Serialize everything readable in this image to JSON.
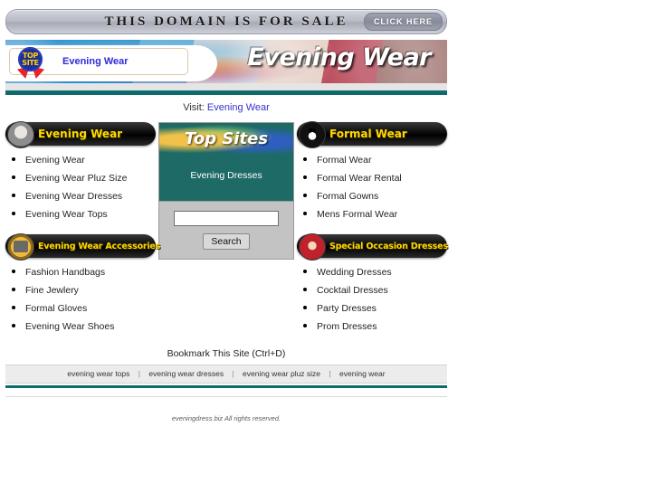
{
  "top_bar": {
    "sale_text": "THIS DOMAIN IS FOR SALE",
    "click_here": "CLICK HERE"
  },
  "header": {
    "badge_top": "TOP",
    "badge_site": "SITE",
    "tab_label": "Evening Wear",
    "banner_title": "Evening Wear"
  },
  "visit": {
    "prefix": "Visit:",
    "link": "Evening Wear"
  },
  "columns": {
    "left": [
      {
        "title": "Evening Wear",
        "icon": "evening-dress-icon",
        "links": [
          "Evening Wear",
          "Evening Wear Pluz Size",
          "Evening Wear Dresses",
          "Evening Wear Tops"
        ]
      },
      {
        "title": "Evening Wear Accessories",
        "icon": "handbag-icon",
        "links": [
          "Fashion Handbags",
          "Fine Jewlery",
          "Formal Gloves",
          "Evening Wear Shoes"
        ]
      }
    ],
    "right": [
      {
        "title": "Formal Wear",
        "icon": "tuxedo-icon",
        "links": [
          "Formal Wear",
          "Formal Wear Rental",
          "Formal Gowns",
          "Mens Formal Wear"
        ]
      },
      {
        "title": "Special Occasion Dresses",
        "icon": "red-dress-icon",
        "links": [
          "Wedding Dresses",
          "Cocktail Dresses",
          "Party Dresses",
          "Prom Dresses"
        ]
      }
    ]
  },
  "topsites": {
    "title": "Top Sites",
    "subtitle": "Evening Dresses",
    "search_value": "",
    "search_placeholder": "",
    "search_button": "Search"
  },
  "footer": {
    "bookmark": "Bookmark This Site (Ctrl+D)",
    "links": [
      "evening wear tops",
      "evening wear dresses",
      "evening wear pluz size",
      "evening wear"
    ],
    "separator": "|",
    "copyright": "eveningdress.biz All rights reserved."
  },
  "colors": {
    "teal": "#0d6b6b",
    "accent_yellow": "#ffd900",
    "link_blue": "#3333cc"
  }
}
